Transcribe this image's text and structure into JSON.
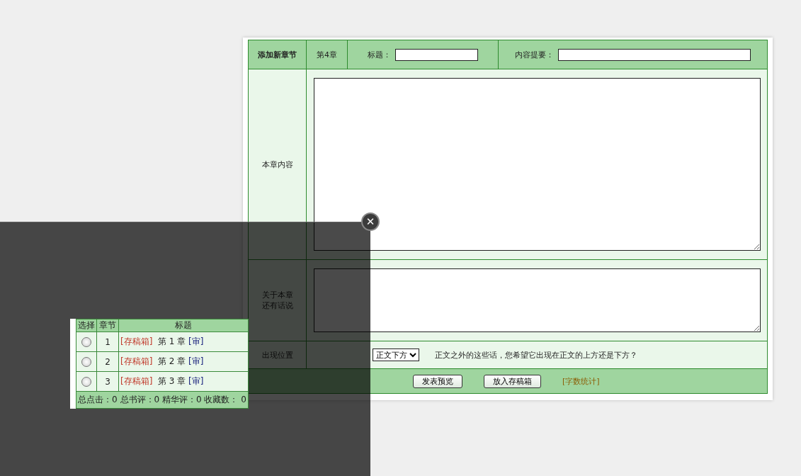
{
  "form": {
    "heading": "添加新章节",
    "chapter": "第4章",
    "title_label": "标题：",
    "summary_label": "内容提要：",
    "content_label": "本章内容",
    "note_label": "关于本章还有话说",
    "position_label": "出现位置",
    "position_select": "正文下方",
    "position_hint": "正文之外的这些话，您希望它出现在正文的上方还是下方？",
    "buttons": [
      "发表预览",
      "放入存稿箱"
    ],
    "word_count_link": "[字数统计]"
  },
  "popup": {
    "columns": [
      "选择",
      "章节",
      "标题"
    ],
    "rows": [
      {
        "selected": false,
        "number": "1",
        "draft_tag": "[存稿箱]",
        "chapter": "第 1 章",
        "review_tag": "[审]"
      },
      {
        "selected": false,
        "number": "2",
        "draft_tag": "[存稿箱]",
        "chapter": "第 2 章",
        "review_tag": "[审]"
      },
      {
        "selected": false,
        "number": "3",
        "draft_tag": "[存稿箱]",
        "chapter": "第 3 章",
        "review_tag": "[审]"
      }
    ],
    "footer": "总点击：0 总书评：0 精华评：0 收藏数： 0",
    "close": "✕"
  }
}
